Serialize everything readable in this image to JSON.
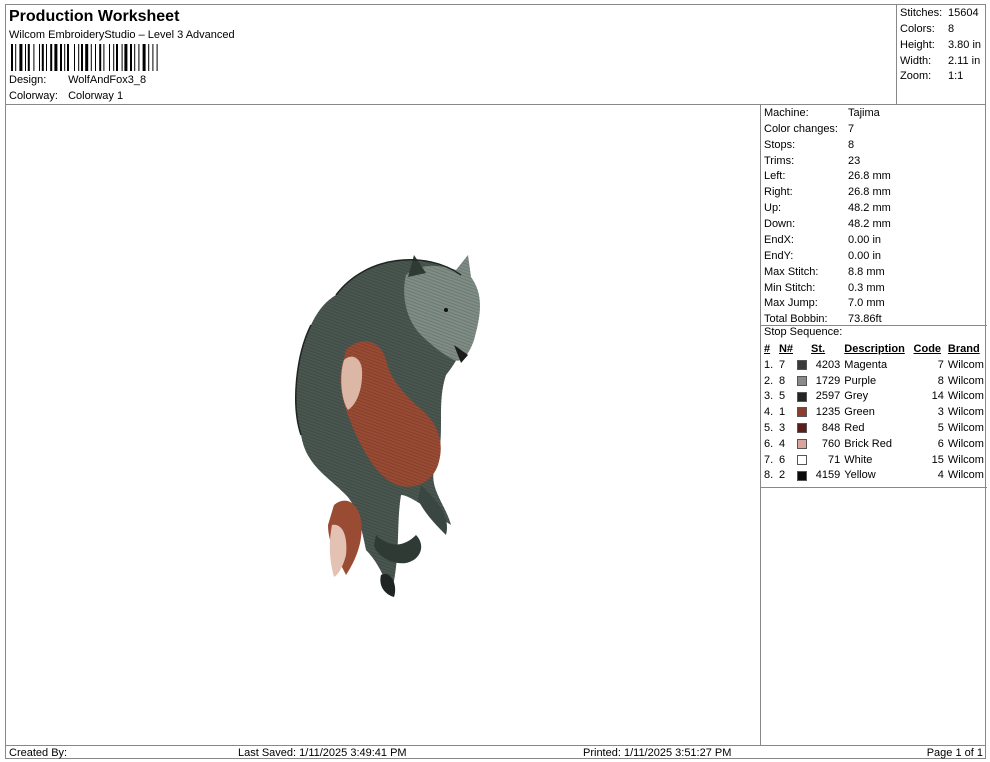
{
  "header": {
    "title": "Production Worksheet",
    "subtitle": "Wilcom EmbroideryStudio – Level 3 Advanced",
    "design_label": "Design:",
    "design_value": "WolfAndFox3_8",
    "colorway_label": "Colorway:",
    "colorway_value": "Colorway 1"
  },
  "stats": [
    {
      "label": "Stitches:",
      "value": "15604"
    },
    {
      "label": "Colors:",
      "value": "8"
    },
    {
      "label": "Height:",
      "value": "3.80 in"
    },
    {
      "label": "Width:",
      "value": "2.11 in"
    },
    {
      "label": "Zoom:",
      "value": "1:1"
    }
  ],
  "properties": [
    {
      "label": "Machine:",
      "value": "Tajima"
    },
    {
      "label": "Color changes:",
      "value": "7"
    },
    {
      "label": "Stops:",
      "value": "8"
    },
    {
      "label": "Trims:",
      "value": "23"
    },
    {
      "label": "Left:",
      "value": "26.8 mm"
    },
    {
      "label": "Right:",
      "value": "26.8 mm"
    },
    {
      "label": "Up:",
      "value": "48.2 mm"
    },
    {
      "label": "Down:",
      "value": "48.2 mm"
    },
    {
      "label": "EndX:",
      "value": "0.00 in"
    },
    {
      "label": "EndY:",
      "value": "0.00 in"
    },
    {
      "label": "Max Stitch:",
      "value": "8.8 mm"
    },
    {
      "label": "Min Stitch:",
      "value": "0.3 mm"
    },
    {
      "label": "Max Jump:",
      "value": "7.0 mm"
    },
    {
      "label": "Total Bobbin:",
      "value": "73.86ft"
    }
  ],
  "stop_sequence": {
    "title": "Stop Sequence:",
    "headers": {
      "idx": "#",
      "n": "N#",
      "st": "St.",
      "desc": "Description",
      "code": "Code",
      "brand": "Brand"
    },
    "rows": [
      {
        "idx": "1.",
        "n": "7",
        "color": "#3a3a3a",
        "st": "4203",
        "desc": "Magenta",
        "code": "7",
        "brand": "Wilcom"
      },
      {
        "idx": "2.",
        "n": "8",
        "color": "#8a8a88",
        "st": "1729",
        "desc": "Purple",
        "code": "8",
        "brand": "Wilcom"
      },
      {
        "idx": "3.",
        "n": "5",
        "color": "#242424",
        "st": "2597",
        "desc": "Grey",
        "code": "14",
        "brand": "Wilcom"
      },
      {
        "idx": "4.",
        "n": "1",
        "color": "#8b3e2f",
        "st": "1235",
        "desc": "Green",
        "code": "3",
        "brand": "Wilcom"
      },
      {
        "idx": "5.",
        "n": "3",
        "color": "#5a1e1a",
        "st": "848",
        "desc": "Red",
        "code": "5",
        "brand": "Wilcom"
      },
      {
        "idx": "6.",
        "n": "4",
        "color": "#d8a49b",
        "st": "760",
        "desc": "Brick Red",
        "code": "6",
        "brand": "Wilcom"
      },
      {
        "idx": "7.",
        "n": "6",
        "color": "#ffffff",
        "st": "71",
        "desc": "White",
        "code": "15",
        "brand": "Wilcom"
      },
      {
        "idx": "8.",
        "n": "2",
        "color": "#0a0a0a",
        "st": "4159",
        "desc": "Yellow",
        "code": "4",
        "brand": "Wilcom"
      }
    ]
  },
  "footer": {
    "created_by": "Created By:",
    "last_saved": "Last Saved: 1/11/2025 3:49:41 PM",
    "printed": "Printed: 1/11/2025 3:51:27 PM",
    "page": "Page 1 of 1"
  }
}
